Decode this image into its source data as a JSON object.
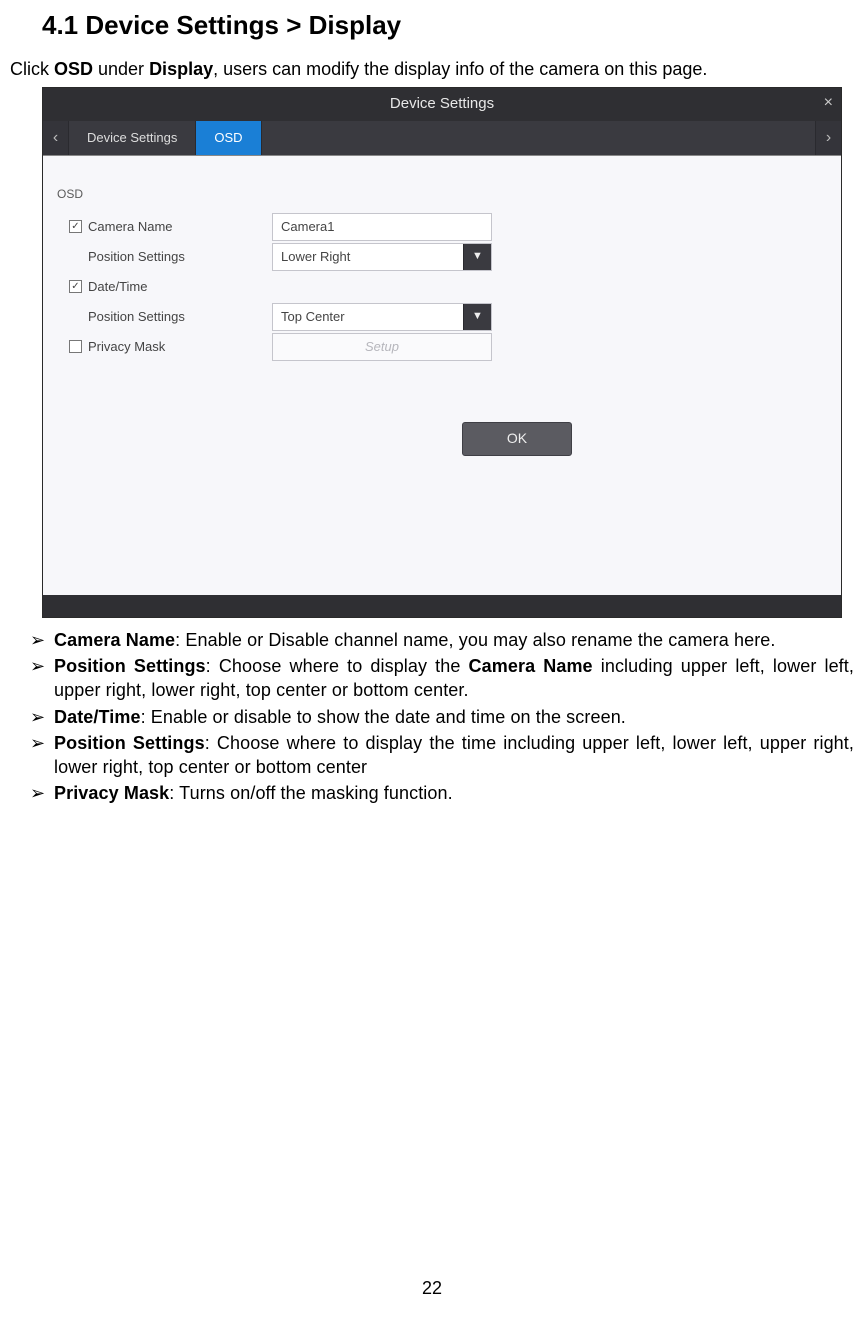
{
  "heading": "4.1 Device Settings > Display",
  "intro_parts": {
    "p1": "Click ",
    "b1": "OSD",
    "p2": " under ",
    "b2": "Display",
    "p3": ", users can modify the display info of the camera on this page."
  },
  "screenshot": {
    "title": "Device Settings",
    "close": "×",
    "arrow_left": "‹",
    "arrow_right": "›",
    "tabs": {
      "t1": "Device Settings",
      "t2": "OSD"
    },
    "group": "OSD",
    "rows": {
      "camera_name_label": "Camera Name",
      "camera_name_value": "Camera1",
      "camera_name_checked": "✓",
      "pos1_label": "Position Settings",
      "pos1_value": "Lower Right",
      "datetime_label": "Date/Time",
      "datetime_checked": "✓",
      "pos2_label": "Position Settings",
      "pos2_value": "Top Center",
      "privacy_label": "Privacy Mask",
      "privacy_checked": "",
      "setup_label": "Setup"
    },
    "ok": "OK",
    "dd": "▼"
  },
  "bullets": {
    "b1_bold": "Camera Name",
    "b1_rest": ": Enable or Disable channel name, you may also rename the camera here.",
    "b2_bold": "Position Settings",
    "b2_mid1": ": Choose where to display the ",
    "b2_bold2": "Camera Name",
    "b2_rest": " including upper left, lower left, upper right, lower right, top center or bottom center.",
    "b3_bold": "Date/Time",
    "b3_rest": ": Enable or disable to show the date and time on the screen.",
    "b4_bold": "Position Settings",
    "b4_rest": ": Choose where to display the time including upper left, lower left, upper right, lower right, top center or bottom center",
    "b5_bold": "Privacy Mask",
    "b5_rest": ": Turns on/off the masking function."
  },
  "pagenum": "22"
}
